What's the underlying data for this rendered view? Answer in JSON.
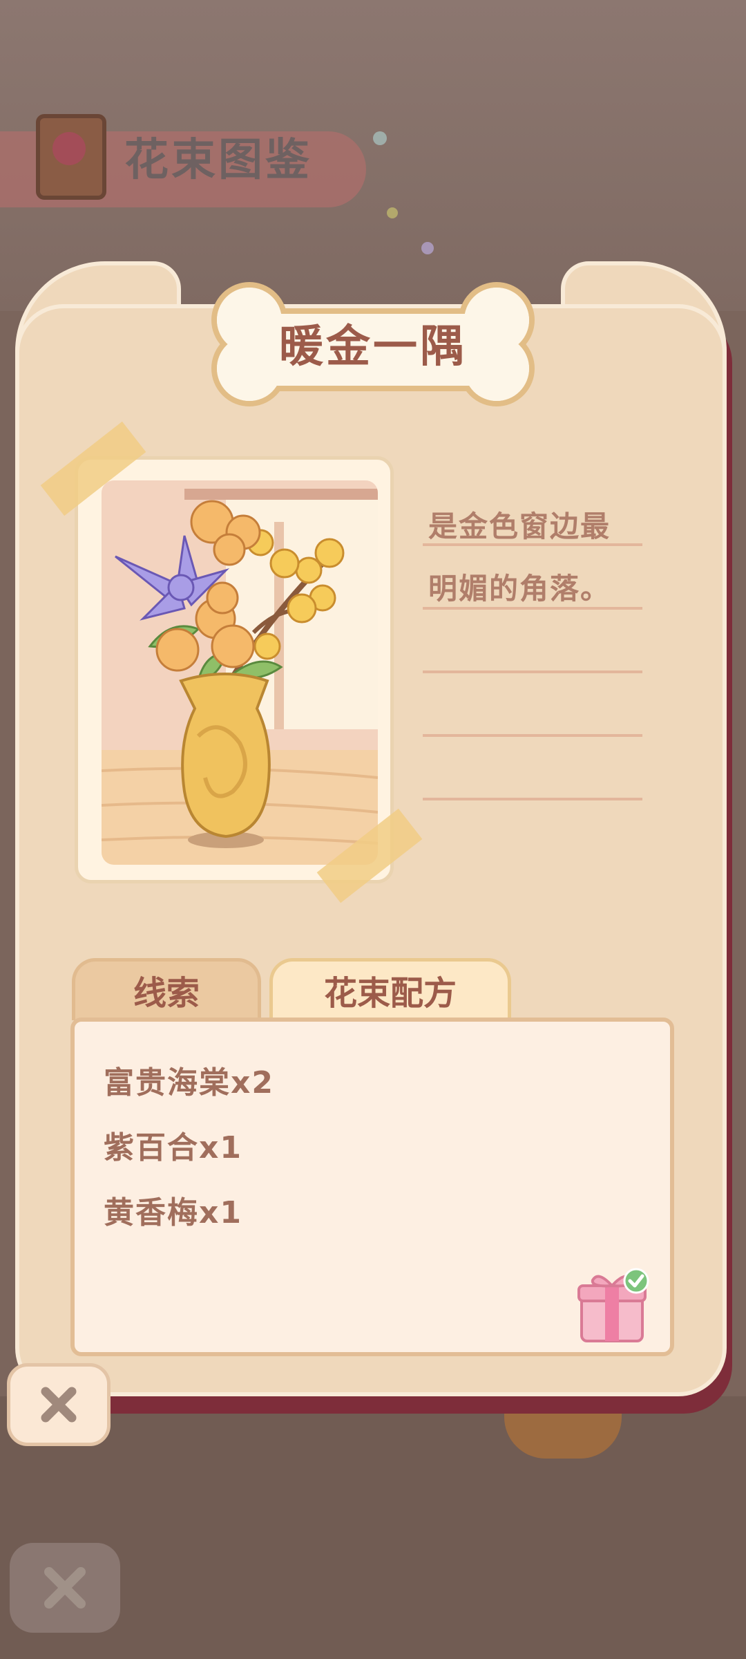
{
  "background": {
    "book_title": "花束图鉴"
  },
  "card": {
    "title": "暖金一隅",
    "description_lines": [
      "是金色窗边最",
      "明媚的角落。",
      "",
      "",
      ""
    ]
  },
  "tabs": [
    {
      "label": "线索",
      "active": false
    },
    {
      "label": "花束配方",
      "active": true
    }
  ],
  "recipe": {
    "items": [
      "富贵海棠x2",
      "紫百合x1",
      "黄香梅x1"
    ],
    "reward_claimed": true
  },
  "icons": {
    "close": "close-icon",
    "gift": "gift-icon",
    "check": "checkmark-icon"
  },
  "colors": {
    "card": "#efd8bb",
    "title_text": "#9c5b4a",
    "accent_gold": "#e2bd86",
    "claimed_green": "#7cc47c"
  }
}
